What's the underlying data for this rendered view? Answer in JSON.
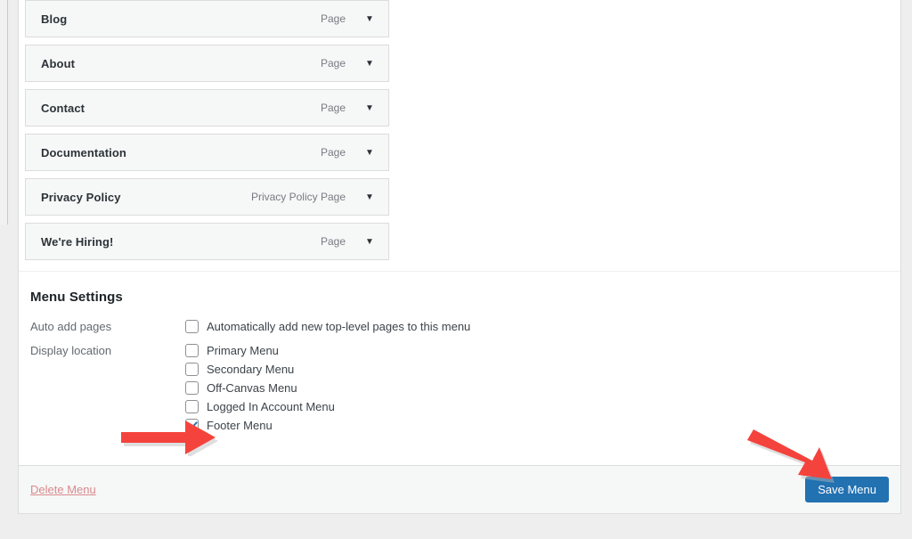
{
  "menu_items": [
    {
      "title": "Blog",
      "type": "Page",
      "toggle_icon": "chevron-down-icon"
    },
    {
      "title": "About",
      "type": "Page",
      "toggle_icon": "chevron-down-icon"
    },
    {
      "title": "Contact",
      "type": "Page",
      "toggle_icon": "chevron-down-icon"
    },
    {
      "title": "Documentation",
      "type": "Page",
      "toggle_icon": "chevron-down-icon"
    },
    {
      "title": "Privacy Policy",
      "type": "Privacy Policy Page",
      "toggle_icon": "chevron-down-icon"
    },
    {
      "title": "We're Hiring!",
      "type": "Page",
      "toggle_icon": "chevron-down-icon"
    }
  ],
  "menu_settings": {
    "heading": "Menu Settings",
    "auto_add_pages": {
      "label": "Auto add pages",
      "checkbox_label": "Automatically add new top-level pages to this menu",
      "checked": false
    },
    "display_location": {
      "label": "Display location",
      "options": [
        {
          "label": "Primary Menu",
          "checked": false
        },
        {
          "label": "Secondary Menu",
          "checked": false
        },
        {
          "label": "Off-Canvas Menu",
          "checked": false
        },
        {
          "label": "Logged In Account Menu",
          "checked": false
        },
        {
          "label": "Footer Menu",
          "checked": true
        }
      ]
    }
  },
  "footer": {
    "delete_label": "Delete Menu",
    "save_label": "Save Menu"
  },
  "colors": {
    "accent_blue": "#2271b1",
    "annotation_red": "#f4433c",
    "delete_link": "#d98a8d",
    "row_background": "#f6f7f7"
  },
  "annotations": [
    {
      "name": "arrow-to-footer-menu-checkbox",
      "direction": "right"
    },
    {
      "name": "arrow-to-save-menu-button",
      "direction": "down-right"
    }
  ]
}
